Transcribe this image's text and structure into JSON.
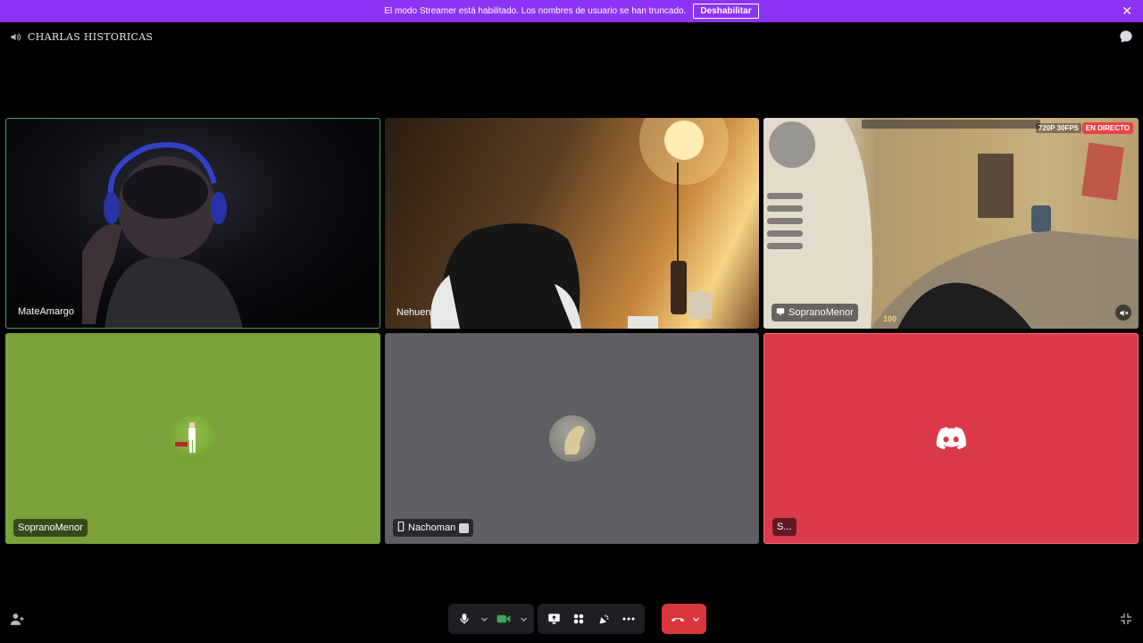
{
  "banner": {
    "message": "El modo Streamer está habilitado. Los nombres de usuario se han truncado.",
    "button_label": "Deshabilitar",
    "close_label": "✕",
    "color": "#8c33f5"
  },
  "header": {
    "channel_name": "CHARLAS HISTORICAS",
    "channel_icon": "speaker-icon",
    "chat_icon": "chat-bubble-icon"
  },
  "tiles": [
    {
      "name": "MateAmargo",
      "speaking": true,
      "type": "camera"
    },
    {
      "name": "Nehuen",
      "type": "camera"
    },
    {
      "name": "SopranoMenor",
      "type": "stream",
      "resolution": "720P 30FPS",
      "live": "EN DIRECTO",
      "hud_health": "100"
    },
    {
      "name": "SopranoMenor",
      "type": "avatar",
      "color": "#7ba23b"
    },
    {
      "name": "Nachoman",
      "type": "avatar",
      "device": "mobile",
      "color": "#5e5e63"
    },
    {
      "name": "S...",
      "type": "placeholder",
      "color": "#da3a4a"
    }
  ],
  "controls": {
    "mic": "microphone-icon",
    "camera": "camera-icon",
    "screen_share": "screen-share-icon",
    "activities": "activities-icon",
    "soundboard": "soundboard-icon",
    "more": "more-icon",
    "disconnect": "hang-up-icon",
    "accent_green": "#3ba55c",
    "accent_red": "#da373c"
  }
}
